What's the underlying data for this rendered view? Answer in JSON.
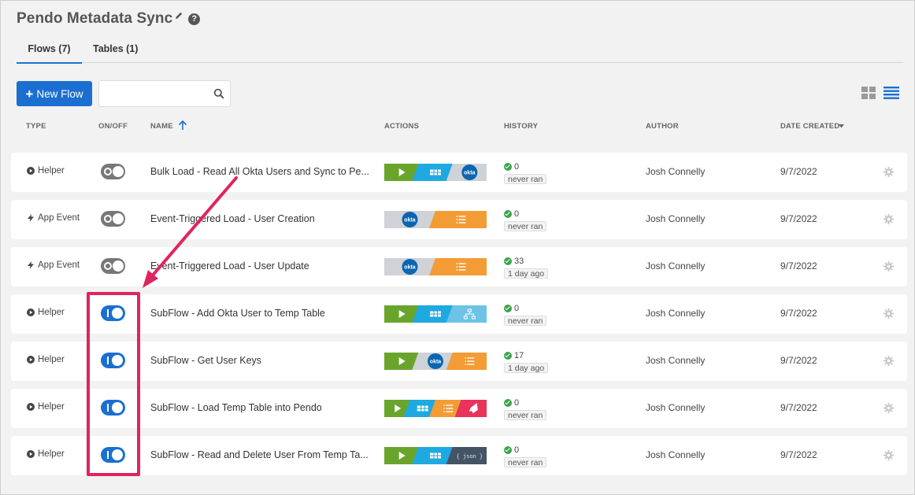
{
  "app": {
    "title": "Pendo Metadata Sync"
  },
  "tabs": [
    {
      "label": "Flows (7)"
    },
    {
      "label": "Tables (1)"
    }
  ],
  "toolbar": {
    "new_flow_label": "New Flow",
    "search_placeholder": "",
    "search_value": ""
  },
  "columns": {
    "type": "TYPE",
    "onoff": "ON/OFF",
    "name": "NAME",
    "actions": "ACTIONS",
    "history": "HISTORY",
    "author": "AUTHOR",
    "date_created": "DATE CREATED"
  },
  "colors": {
    "accent": "#1a6fd1",
    "highlight": "#e0245e",
    "success": "#3fa34d",
    "toggle_off": "#777777"
  },
  "flows": [
    {
      "type": "Helper",
      "type_icon": "play-circle-icon",
      "on": false,
      "name": "Bulk Load - Read All Okta Users and Sync to Pe...",
      "actions": [
        "trigger",
        "table",
        "okta"
      ],
      "history_count": "0",
      "history_status": "never ran",
      "author": "Josh Connelly",
      "date": "9/7/2022"
    },
    {
      "type": "App Event",
      "type_icon": "lightning-icon",
      "on": false,
      "name": "Event-Triggered Load - User Creation",
      "actions": [
        "okta",
        "list"
      ],
      "history_count": "0",
      "history_status": "never ran",
      "author": "Josh Connelly",
      "date": "9/7/2022"
    },
    {
      "type": "App Event",
      "type_icon": "lightning-icon",
      "on": false,
      "name": "Event-Triggered Load - User Update",
      "actions": [
        "okta",
        "list"
      ],
      "history_count": "33",
      "history_status": "1 day ago",
      "author": "Josh Connelly",
      "date": "9/7/2022"
    },
    {
      "type": "Helper",
      "type_icon": "play-circle-icon",
      "on": true,
      "name": "SubFlow - Add Okta User to Temp Table",
      "actions": [
        "trigger",
        "table",
        "tree"
      ],
      "history_count": "0",
      "history_status": "never ran",
      "author": "Josh Connelly",
      "date": "9/7/2022"
    },
    {
      "type": "Helper",
      "type_icon": "play-circle-icon",
      "on": true,
      "name": "SubFlow - Get User Keys",
      "actions": [
        "trigger",
        "okta",
        "list"
      ],
      "history_count": "17",
      "history_status": "1 day ago",
      "author": "Josh Connelly",
      "date": "9/7/2022"
    },
    {
      "type": "Helper",
      "type_icon": "play-circle-icon",
      "on": true,
      "name": "SubFlow - Load Temp Table into Pendo",
      "actions": [
        "trigger",
        "table",
        "list",
        "pendo"
      ],
      "history_count": "0",
      "history_status": "never ran",
      "author": "Josh Connelly",
      "date": "9/7/2022"
    },
    {
      "type": "Helper",
      "type_icon": "play-circle-icon",
      "on": true,
      "name": "SubFlow - Read and Delete User From Temp Ta...",
      "actions": [
        "trigger",
        "table",
        "json"
      ],
      "history_count": "0",
      "history_status": "never ran",
      "author": "Josh Connelly",
      "date": "9/7/2022"
    }
  ],
  "action_cards": {
    "trigger": {
      "color": "#6aa52b",
      "icon": "play-icon"
    },
    "table": {
      "color": "#1ea9e1",
      "icon": "table-icon"
    },
    "okta": {
      "color": "#cfd2d6",
      "icon": "okta-logo",
      "label": "okta"
    },
    "list": {
      "color": "#f39c35",
      "icon": "list-icon"
    },
    "tree": {
      "color": "#6cc3e6",
      "icon": "tree-icon"
    },
    "pendo": {
      "color": "#e8335a",
      "icon": "pendo-icon"
    },
    "json": {
      "color": "#445466",
      "icon": "json-icon",
      "label": "{ json }"
    }
  }
}
